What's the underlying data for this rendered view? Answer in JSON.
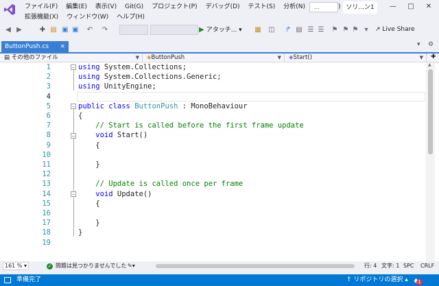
{
  "menu": {
    "row1": [
      "ファイル(F)",
      "編集(E)",
      "表示(V)",
      "Git(G)",
      "プロジェクト(P)",
      "デバッグ(D)",
      "テスト(S)",
      "分析(N)",
      "ツール(T)"
    ],
    "row2": [
      "拡張機能(X)",
      "ウィンドウ(W)",
      "ヘルプ(H)"
    ],
    "search_label": "...",
    "solution_name": "ソリ...ン1"
  },
  "toolbar": {
    "attach_label": "アタッチ...",
    "live_share_label": "Live Share"
  },
  "tab": {
    "label": "ButtonPush.cs",
    "close": "×"
  },
  "navbar": {
    "project": "その他のファイル",
    "class": "ButtonPush",
    "member": "Start()"
  },
  "editor": {
    "line_numbers": [
      "1",
      "2",
      "3",
      "4",
      "5",
      "6",
      "7",
      "8",
      "9",
      "10",
      "11",
      "12",
      "13",
      "14",
      "15",
      "16",
      "17",
      "18",
      "19"
    ],
    "current_line": 4
  },
  "edstatus": {
    "zoom": "161 %",
    "issues": "問題は見つかりませんでした",
    "line": "行: 4",
    "col": "文字: 1",
    "ws": "SPC",
    "eol": "CRLF"
  },
  "statusbar": {
    "ready": "準備完了",
    "repo": "リポジトリの選択",
    "notifications": "1"
  },
  "colors": {
    "accent": "#0078d4",
    "tab_active": "#3a7fd6",
    "keyword": "#0000ff",
    "type": "#2b91af",
    "comment": "#008000"
  }
}
